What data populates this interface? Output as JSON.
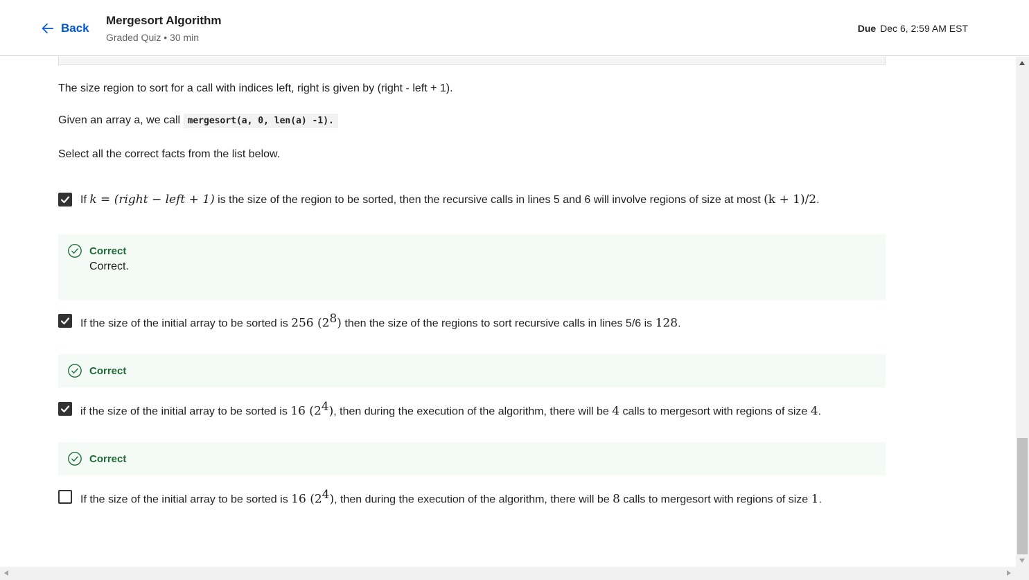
{
  "header": {
    "back_label": "Back",
    "title": "Mergesort Algorithm",
    "subtitle": "Graded Quiz • 30 min",
    "due_label": "Due",
    "due_value": "Dec 6, 2:59 AM EST"
  },
  "question": {
    "para1": "The size region to sort for a call with indices left, right is given by (right - left + 1).",
    "para2_prefix": "Given an array a, we call ",
    "para2_code": "mergesort(a, 0, len(a) -1).",
    "para3": "Select all the correct facts from the list below."
  },
  "options": [
    {
      "checked": true,
      "t1": "If ",
      "m1": "k = (right − left + 1)",
      "t2": " is the size of the region to be sorted, then the recursive calls in lines 5 and 6 will involve regions of size at most ",
      "m2": "(k + 1)/2",
      "t3": "."
    },
    {
      "checked": true,
      "t1": "If the size of the initial array to be sorted is ",
      "m1": "256",
      "m1b": " (2",
      "sup": "8",
      "m1c": ")",
      "t2": " then the size of the regions to sort recursive calls in lines 5/6 is ",
      "m2": "128",
      "t3": "."
    },
    {
      "checked": true,
      "t1": "if the size of the initial array to be sorted is ",
      "m1": "16",
      "m1b": " (2",
      "sup": "4",
      "m1c": ")",
      "t2": ", then during the execution of the algorithm, there will be ",
      "m2": "4",
      "t3": " calls  to mergesort with regions of size ",
      "m3": "4",
      "t4": "."
    },
    {
      "checked": false,
      "t1": "If the size of the initial array to be sorted is ",
      "m1": "16",
      "m1b": " (2",
      "sup": "4",
      "m1c": ")",
      "t2": ", then during the execution of the algorithm, there will be ",
      "m2": "8",
      "t3": " calls  to mergesort with regions of size ",
      "m3": "1",
      "t4": "."
    }
  ],
  "feedback": [
    {
      "label": "Correct",
      "body": "Correct."
    },
    {
      "label": "Correct"
    },
    {
      "label": "Correct"
    }
  ],
  "colors": {
    "accent": "#0056d2",
    "correct_green": "#1e6b34",
    "feedback_bg": "#f4faf6"
  },
  "icons": {
    "back": "arrow-left-icon",
    "checkbox": "checkbox-checked-icon",
    "correct": "check-circle-icon"
  }
}
